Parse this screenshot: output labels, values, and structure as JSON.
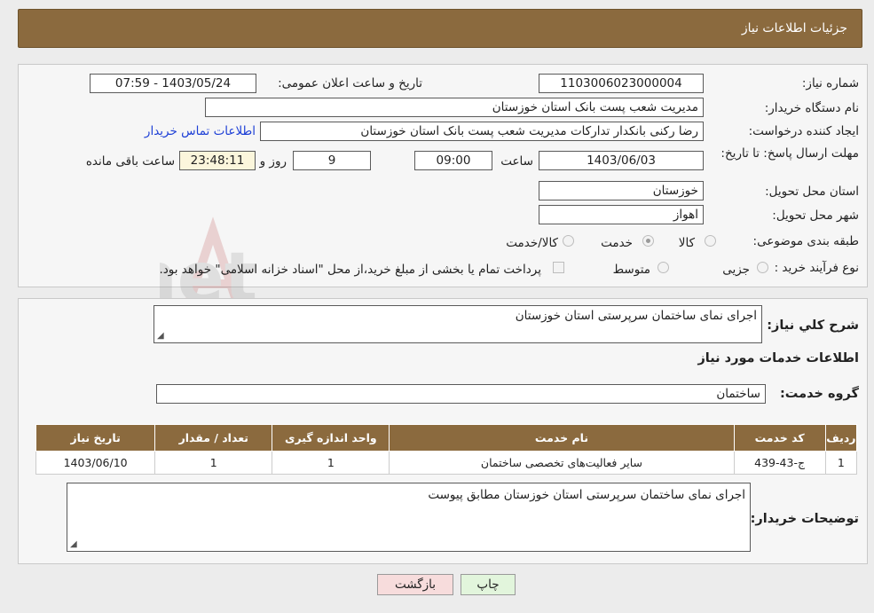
{
  "header": {
    "title": "جزئیات اطلاعات نیاز"
  },
  "form": {
    "need_number": {
      "label": "شماره نیاز:",
      "value": "1103006023000004"
    },
    "announce_datetime": {
      "label": "تاریخ و ساعت اعلان عمومی:",
      "value": "1403/05/24 - 07:59"
    },
    "buyer_org": {
      "label": "نام دستگاه خریدار:",
      "value": "مدیریت شعب پست بانک استان خوزستان"
    },
    "creator": {
      "label": "ایجاد کننده درخواست:",
      "value": "رضا رکنی بانکدار تدارکات  مدیریت شعب پست بانک استان خوزستان",
      "contact_link": "اطلاعات تماس خریدار"
    },
    "deadline": {
      "label": "مهلت ارسال پاسخ: تا تاریخ:",
      "date": "1403/06/03",
      "time_label": "ساعت",
      "time": "09:00",
      "days": "9",
      "days_label": "روز و",
      "remaining": "23:48:11",
      "remaining_label": "ساعت باقی مانده"
    },
    "province": {
      "label": "استان محل تحویل:",
      "value": "خوزستان"
    },
    "city": {
      "label": "شهر محل تحویل:",
      "value": "اهواز"
    },
    "category": {
      "label": "طبقه بندی موضوعی:",
      "options": [
        "کالا",
        "خدمت",
        "کالا/خدمت"
      ],
      "selected": "خدمت"
    },
    "process_type": {
      "label": "نوع فرآیند خرید :",
      "options": [
        "جزیی",
        "متوسط"
      ],
      "note": "پرداخت تمام یا بخشی از مبلغ خرید،از محل \"اسناد خزانه اسلامی\" خواهد بود."
    }
  },
  "details": {
    "summary_label": "شرح کلي نياز:",
    "summary": "اجرای نمای ساختمان سرپرستی استان خوزستان",
    "services_title": "اطلاعات خدمات مورد نیاز",
    "service_group_label": "گروه خدمت:",
    "service_group": "ساختمان",
    "table": {
      "headers": [
        "ردیف",
        "کد خدمت",
        "نام خدمت",
        "واحد اندازه گیری",
        "تعداد / مقدار",
        "تاریخ نیاز"
      ],
      "rows": [
        [
          "1",
          "ج-43-439",
          "سایر فعالیت‌های تخصصی ساختمان",
          "1",
          "1",
          "1403/06/10"
        ]
      ]
    },
    "buyer_notes_label": "توضیحات خریدار:",
    "buyer_notes": "اجرای نمای ساختمان سرپرستی استان خوزستان مطابق پیوست"
  },
  "buttons": {
    "print": "چاپ",
    "back": "بازگشت"
  },
  "watermark": "AriaTender.net",
  "colors": {
    "header": "#8b6a3e",
    "link": "#1d3fd6",
    "back_button": "#f7dcdc",
    "print_button": "#e2f5dc"
  }
}
